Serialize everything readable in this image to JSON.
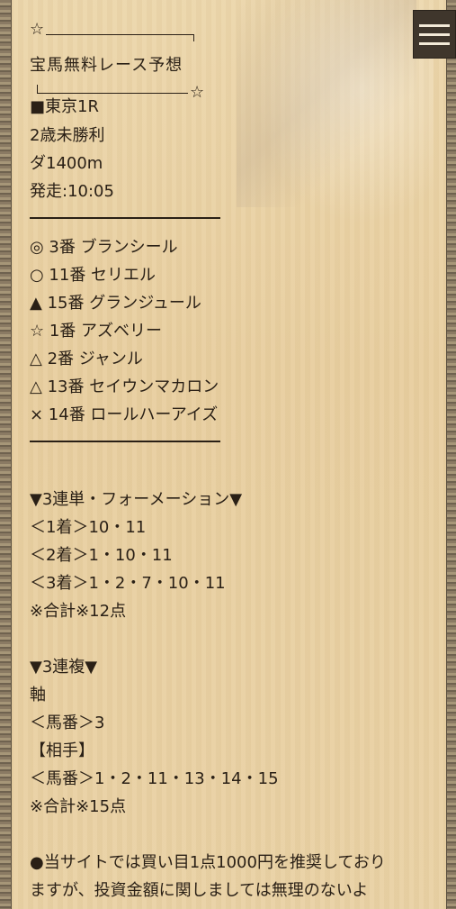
{
  "header": {
    "star_top": "☆",
    "title": "宝馬無料レース予想",
    "star_bottom": "☆"
  },
  "race": {
    "venue": "■東京1R",
    "class": "2歳未勝利",
    "course": "ダ1400m",
    "start": "発走:10:05"
  },
  "picks": [
    "◎ 3番 ブランシール",
    "○ 11番 セリエル",
    "▲ 15番 グランジュール",
    "☆ 1番 アズベリー",
    "△ 2番 ジャンル",
    "△ 13番 セイウンマカロン",
    "× 14番 ロールハーアイズ"
  ],
  "trifecta": {
    "heading": "▼3連単・フォーメーション▼",
    "first": "＜1着＞10・11",
    "second": "＜2着＞1・10・11",
    "third": "＜3着＞1・2・7・10・11",
    "total": "※合計※12点"
  },
  "trio": {
    "heading": "▼3連複▼",
    "axis_label": "軸",
    "axis": "＜馬番＞3",
    "partner_label": "【相手】",
    "partners": "＜馬番＞1・2・11・13・14・15",
    "total": "※合計※15点"
  },
  "note": {
    "line1": "●当サイトでは買い目1点1000円を推奨しており",
    "line2": "ますが、投資金額に関しましては無理のないよ"
  },
  "colors": {
    "text": "#2a2016",
    "background": "#e9d2a6",
    "menu_button": "#3f362c"
  },
  "icons": {
    "menu": "hamburger-icon"
  }
}
